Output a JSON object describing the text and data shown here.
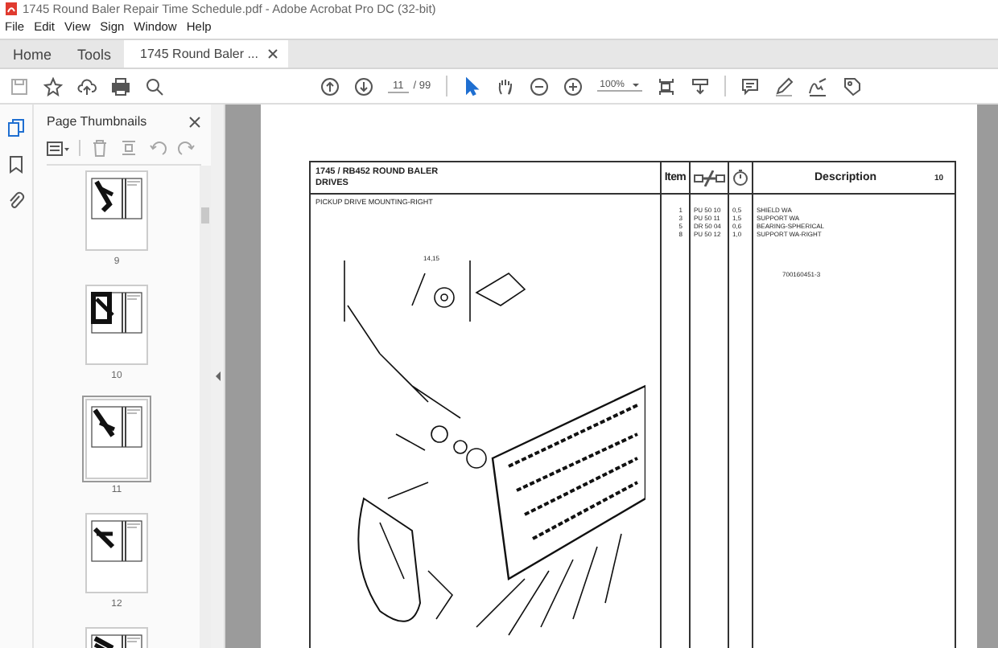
{
  "window": {
    "title": "1745 Round Baler Repair Time Schedule.pdf - Adobe Acrobat Pro DC (32-bit)"
  },
  "menu": [
    "File",
    "Edit",
    "View",
    "Sign",
    "Window",
    "Help"
  ],
  "tabs": [
    {
      "label": "Home",
      "selected": false
    },
    {
      "label": "Tools",
      "selected": false
    },
    {
      "label": "1745 Round Baler ...",
      "selected": true
    }
  ],
  "toolbar": {
    "page": "11",
    "total": "/ 99",
    "zoom": "100%"
  },
  "sidebar": {
    "title": "Page Thumbnails",
    "thumbnails": [
      {
        "label": "9",
        "selected": false
      },
      {
        "label": "10",
        "selected": false
      },
      {
        "label": "11",
        "selected": true
      },
      {
        "label": "12",
        "selected": false
      }
    ]
  },
  "document": {
    "title": "1745 / RB452 ROUND BALER",
    "subtitle": "DRIVES",
    "item_heading": "Item",
    "description_heading": "Description",
    "page_number": "10",
    "section": "PICKUP DRIVE MOUNTING-RIGHT",
    "callout": "14,15",
    "parts": [
      {
        "item": "1",
        "code": "PU 50 10",
        "time": "0,5",
        "description": "SHIELD WA"
      },
      {
        "item": "3",
        "code": "PU 50 11",
        "time": "1,5",
        "description": "SUPPORT WA"
      },
      {
        "item": "5",
        "code": "DR 50 04",
        "time": "0,6",
        "description": "BEARING-SPHERICAL"
      },
      {
        "item": "8",
        "code": "PU 50 12",
        "time": "1,0",
        "description": "SUPPORT WA-RIGHT"
      }
    ],
    "reference": "700160451-3"
  }
}
